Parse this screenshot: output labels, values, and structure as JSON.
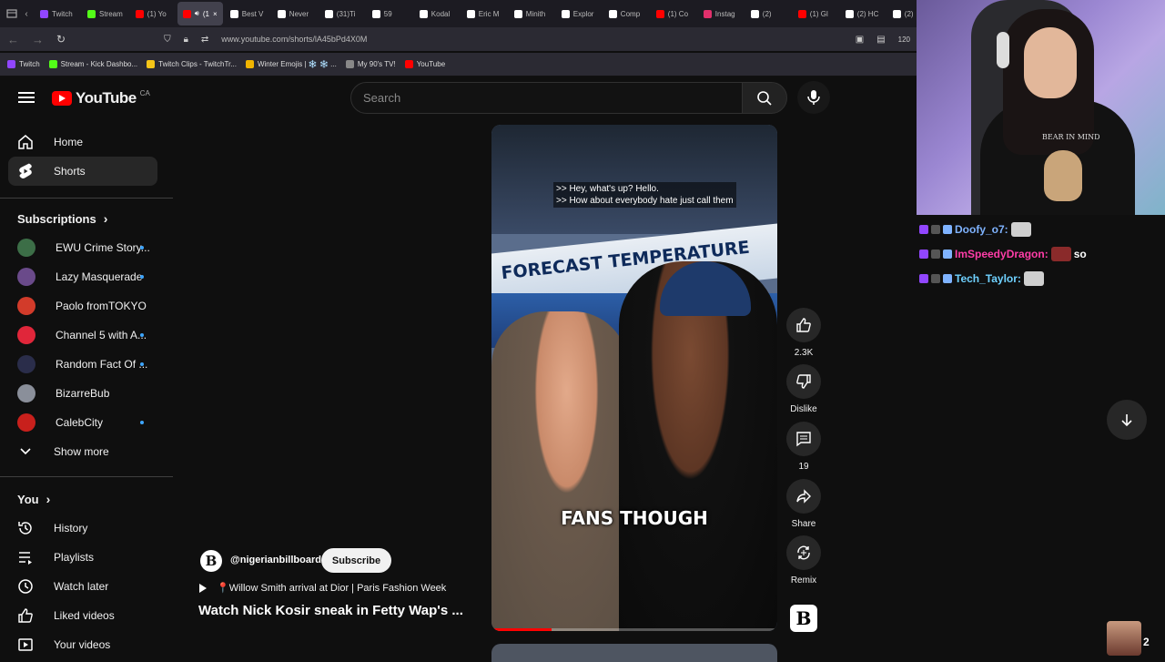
{
  "browser": {
    "tabs": [
      {
        "label": "Twitch",
        "color": "#9146ff"
      },
      {
        "label": "Stream",
        "color": "#53fc18"
      },
      {
        "label": "(1) Yo",
        "color": "#ff0000"
      },
      {
        "label": "(1",
        "color": "#ff0000",
        "active": true
      },
      {
        "label": "Best V",
        "color": "#ffffff"
      },
      {
        "label": "Never",
        "color": "#ffffff"
      },
      {
        "label": "(31)Ti",
        "color": "#ffffff"
      },
      {
        "label": "59",
        "color": "#ffffff"
      },
      {
        "label": "Kodal",
        "color": "#ffffff"
      },
      {
        "label": "Eric M",
        "color": "#ffffff"
      },
      {
        "label": "Minith",
        "color": "#ffffff"
      },
      {
        "label": "Explor",
        "color": "#ffffff"
      },
      {
        "label": "Comp",
        "color": "#ffffff"
      },
      {
        "label": "(1) Co",
        "color": "#ff0000"
      },
      {
        "label": "Instag",
        "color": "#e1306c"
      },
      {
        "label": "(2)",
        "color": "#ffffff"
      },
      {
        "label": "(1) Gl",
        "color": "#ff0000"
      },
      {
        "label": "(2) HC",
        "color": "#ffffff"
      },
      {
        "label": "(2)",
        "color": "#ffffff"
      }
    ],
    "url": "www.youtube.com/shorts/lA45bPd4X0M",
    "zoom": "120",
    "bookmarks": [
      {
        "label": "Twitch",
        "color": "#9146ff"
      },
      {
        "label": "Stream - Kick Dashbo...",
        "color": "#53fc18"
      },
      {
        "label": "Twitch Clips - TwitchTr...",
        "color": "#f5c518"
      },
      {
        "label": "Winter Emojis | ❄️ ❄️ ...",
        "color": "#f0b400"
      },
      {
        "label": "My 90's TV!",
        "color": "#888888"
      },
      {
        "label": "YouTube",
        "color": "#ff0000"
      }
    ]
  },
  "header": {
    "logo": "YouTube",
    "country": "CA",
    "search_placeholder": "Search"
  },
  "sidebar": {
    "main": [
      {
        "label": "Home",
        "icon": "home-icon"
      },
      {
        "label": "Shorts",
        "icon": "shorts-icon",
        "active": true
      }
    ],
    "subscriptions_title": "Subscriptions",
    "subscriptions": [
      {
        "label": "EWU Crime Story...",
        "color": "#3c6e47",
        "dot": true
      },
      {
        "label": "Lazy Masquerade",
        "color": "#6a4a8a",
        "dot": true
      },
      {
        "label": "Paolo fromTOKYO",
        "color": "#d23b2a",
        "dot": false
      },
      {
        "label": "Channel 5 with A...",
        "color": "#e0263a",
        "dot": true
      },
      {
        "label": "Random Fact Of ...",
        "color": "#2a2d4a",
        "dot": true
      },
      {
        "label": "BizarreBub",
        "color": "#8a8f9a",
        "dot": false
      },
      {
        "label": "CalebCity",
        "color": "#c8201c",
        "dot": true
      }
    ],
    "show_more": "Show more",
    "you_title": "You",
    "you": [
      {
        "label": "History",
        "icon": "history-icon"
      },
      {
        "label": "Playlists",
        "icon": "playlists-icon"
      },
      {
        "label": "Watch later",
        "icon": "clock-icon"
      },
      {
        "label": "Liked videos",
        "icon": "thumbs-up-icon"
      },
      {
        "label": "Your videos",
        "icon": "play-square-icon"
      }
    ]
  },
  "video": {
    "caption_top": ">> Hey, what's up? Hello.\n>> How about everybody hate just call them",
    "banner_text": "FORECAST TEMPERATURE",
    "caption_bottom": "FANS THOUGH",
    "progress_fraction": 0.21
  },
  "actions": {
    "likes": "2.3K",
    "dislike": "Dislike",
    "comments": "19",
    "share": "Share",
    "remix": "Remix"
  },
  "meta": {
    "handle": "@nigerianbillboard",
    "subscribe": "Subscribe",
    "song": "📍Willow Smith arrival at Dior | Paris Fashion Week",
    "title": "Watch Nick Kosir sneak in Fetty Wap's ..."
  },
  "overlay": {
    "webcam_shirt_text": "BEAR IN MIND",
    "chat": [
      {
        "user": "Doofy_o7:",
        "color": "#7fb3ff",
        "msg": ""
      },
      {
        "user": "ImSpeedyDragon:",
        "color": "#ff3da8",
        "msg": "so"
      },
      {
        "user": "Tech_Taylor:",
        "color": "#6fd1ff",
        "msg": ""
      }
    ],
    "viewer_count": "2"
  }
}
